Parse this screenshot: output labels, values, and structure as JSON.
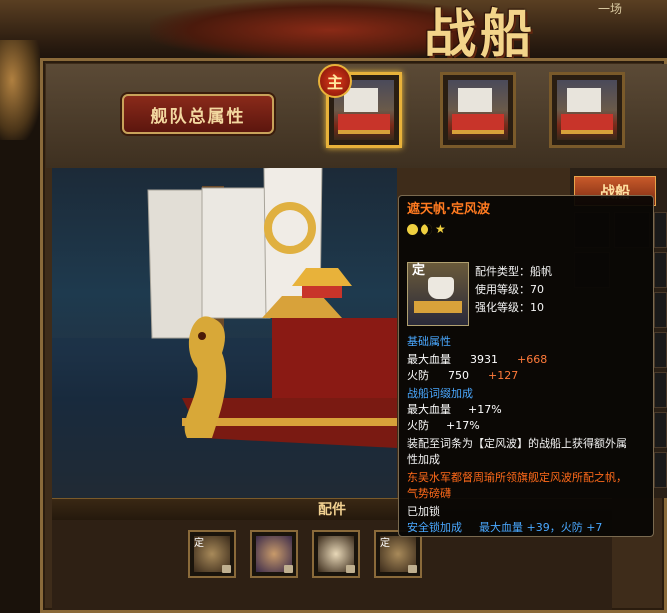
{
  "header": {
    "title": "战船",
    "side_text": "一场"
  },
  "fleet_button": {
    "label": "舰队总属性"
  },
  "ship_slots": [
    {
      "badge": "主",
      "selected": true
    },
    {
      "selected": false
    },
    {
      "selected": false
    }
  ],
  "right_tab": {
    "label": "战船"
  },
  "parts": {
    "label": "配件",
    "slots": [
      {
        "glyph": "定",
        "locked": true
      },
      {
        "locked": true
      },
      {
        "locked": true
      },
      {
        "glyph": "定",
        "locked": true
      }
    ]
  },
  "tooltip": {
    "name": "遮天帆·定风波",
    "rating_icons": [
      "face-icon",
      "moon-icon",
      "star-icon"
    ],
    "icon_glyph": "定",
    "type_line": "配件类型：船帆",
    "use_level": "使用等级：70",
    "enhance_level": "强化等级：10",
    "base_header": "基础属性",
    "base_stats": [
      {
        "label": "最大血量",
        "value": "3931",
        "bonus": "+668"
      },
      {
        "label": "火防",
        "value": "750",
        "bonus": "+127"
      }
    ],
    "affix_header": "战船词缀加成",
    "affix_stats": [
      {
        "label": "最大血量",
        "value": "+17%"
      },
      {
        "label": "火防",
        "value": "+17%"
      }
    ],
    "set_desc_1": "装配至词条为【定风波】的战船上获得额外属",
    "set_desc_2": "性加成",
    "lore_1": "东吴水军都督周瑜所领旗舰定风波所配之帆，",
    "lore_2": "气势磅礴",
    "lock_status": "已加锁",
    "lock_bonus_label": "安全锁加成",
    "lock_bonus_value": "最大血量 +39，火防 +7"
  },
  "colors": {
    "item_name": "#ff7a20",
    "section_header": "#4aa8ff",
    "bonus": "#ff7a3a",
    "frame_gold": "#c8a25a"
  }
}
